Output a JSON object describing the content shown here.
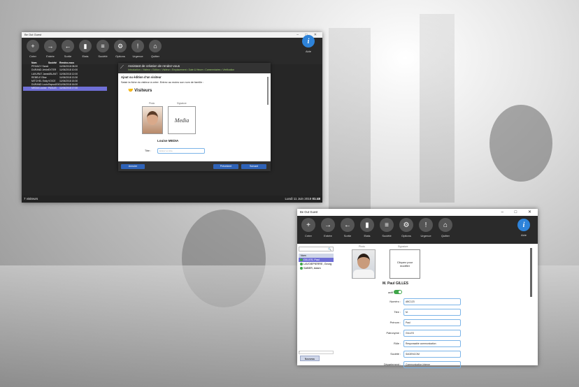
{
  "window1": {
    "title": "Be Out Guest",
    "controls": "– □ ✕",
    "toolbar": [
      {
        "label": "Créer",
        "icon": "person-add-icon",
        "glyph": "+"
      },
      {
        "label": "Entrée",
        "icon": "walk-in-icon",
        "glyph": "→"
      },
      {
        "label": "Sortie",
        "icon": "walk-out-icon",
        "glyph": "←"
      },
      {
        "label": "Etats",
        "icon": "chart-icon",
        "glyph": "▮"
      },
      {
        "label": "Société",
        "icon": "database-icon",
        "glyph": "≡"
      },
      {
        "label": "Options",
        "icon": "gears-icon",
        "glyph": "⚙"
      },
      {
        "label": "Urgence",
        "icon": "siren-icon",
        "glyph": "!"
      },
      {
        "label": "Quitter",
        "icon": "home-icon",
        "glyph": "⌂"
      }
    ],
    "help_label": "Aide",
    "help_glyph": "i",
    "list_headers": [
      "",
      "Nom",
      "Société",
      "Rendez-vous"
    ],
    "list_rows": [
      [
        "",
        "PRIVACY Sandra",
        "",
        "11/06/2018 08:00"
      ],
      [
        "",
        "DURAND Jérôme",
        "EXTER",
        "11/06/2018 10:00"
      ],
      [
        "",
        "LAVURAT James",
        "ABLANT",
        "11/06/2018 12:00"
      ],
      [
        "",
        "REBELE Elise",
        "",
        "11/06/2018 13:30"
      ],
      [
        "",
        "MITCHEL Eddy",
        "VOICE",
        "11/06/2018 15:30"
      ],
      [
        "",
        "DURAND Louis",
        "Rapsol2000",
        "11/06/2018 16:00"
      ],
      [
        "",
        "MEDIA Louise",
        "PASLIB",
        "11/06/2018 17:00"
      ]
    ],
    "status_left": "7 visiteurs",
    "status_date": "Lundi 11 Juin 2018",
    "status_time": "01:48"
  },
  "dialog": {
    "title": "Assistant de création de rendez-vous",
    "steps": "Introduction • Visiteur • Edition • Visiteur • Emplacement • Date & Heure • Commentaires • Vérification",
    "section_title": "Ajout ou édition d'un visiteur",
    "instruction": "Saisir la fiche du visiteur à créer. Entrez au moins son nom de famille :",
    "visitors_heading": "Visiteurs",
    "photo_caption": "Photo",
    "signature_caption": "Signature",
    "signature_text": "Media",
    "visitor_name": "Louise MEDIA",
    "title_label": "Titre :",
    "title_placeholder": "Entrez un titre",
    "cancel_label": "Annuler",
    "previous_label": "Précédent",
    "next_label": "Suivant"
  },
  "window2": {
    "title": "Be Out Guest",
    "controls": "– □ ✕",
    "toolbar": [
      {
        "label": "Créer",
        "icon": "person-add-icon",
        "glyph": "+"
      },
      {
        "label": "Entrée",
        "icon": "walk-in-icon",
        "glyph": "→"
      },
      {
        "label": "Sortie",
        "icon": "walk-out-icon",
        "glyph": "←"
      },
      {
        "label": "Etats",
        "icon": "chart-icon",
        "glyph": "▮"
      },
      {
        "label": "Société",
        "icon": "database-icon",
        "glyph": "≡"
      },
      {
        "label": "Options",
        "icon": "gears-icon",
        "glyph": "⚙"
      },
      {
        "label": "Urgence",
        "icon": "siren-icon",
        "glyph": "!"
      },
      {
        "label": "Quitter",
        "icon": "home-icon",
        "glyph": "⌂"
      }
    ],
    "help_label": "Aide",
    "help_glyph": "i",
    "search_glyph": "🔍",
    "list_header": "Nom",
    "people": [
      "GILLES, Paul",
      "LAVOIEPIERRE, Georg",
      "SABER, Adam"
    ],
    "new_label": "Nouveau",
    "photo_caption": "Photo",
    "signature_caption": "Signature",
    "signature_text": "Cliquez pour modifier",
    "person_name": "M. Paul GILLES",
    "active_label": "actif",
    "fields": [
      {
        "label": "Numéro :",
        "value": "ABC123"
      },
      {
        "label": "Titre :",
        "value": "M."
      },
      {
        "label": "Prénom :",
        "value": "Paul"
      },
      {
        "label": "Patronyme :",
        "value": "GILLES"
      },
      {
        "label": "Rôle :",
        "value": "Responsable communication"
      },
      {
        "label": "Société :",
        "value": "SAGENCOM"
      },
      {
        "label": "Département :",
        "value": "Communication Interne"
      }
    ]
  },
  "colors": {
    "toolbar_bg": "#2a2a2a",
    "selection": "#6f6fd6",
    "accent_blue": "#2e83d9",
    "button_blue": "#2f63b8",
    "active_green": "#3fa64a",
    "wizard_steps": "#9fd16d"
  }
}
